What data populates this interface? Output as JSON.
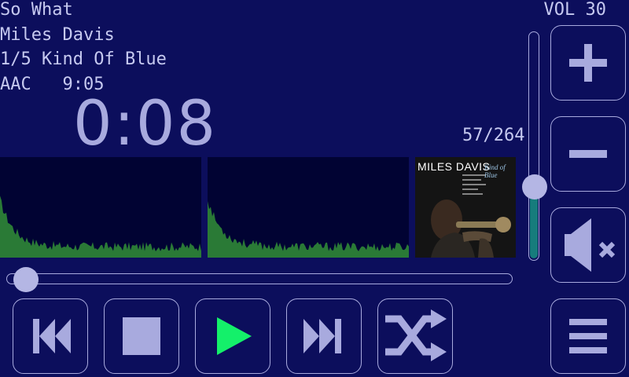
{
  "track": {
    "title": "So What",
    "artist": "Miles Davis",
    "album_line": "1/5 Kind Of Blue",
    "format_line": "AAC   9:05",
    "elapsed": "0:08",
    "counter": "57/264"
  },
  "volume": {
    "label": "VOL 30",
    "level": 0.3
  },
  "seek": {
    "fraction": 0.015
  },
  "album_art": {
    "artist_text": "MILES DAVIS",
    "album_text": "Kind of Blue"
  },
  "visualizer": {
    "color": "#2a7a36",
    "background": "#010333"
  },
  "colors": {
    "background": "#0c0e5c",
    "foreground": "#a8aade",
    "play_accent": "#14f06a",
    "volume_fill": "#167c7c"
  },
  "buttons": {
    "prev": "previous-icon",
    "stop": "stop-icon",
    "play": "play-icon",
    "next": "next-icon",
    "shuffle": "shuffle-icon",
    "menu": "menu-icon",
    "vol_up": "plus-icon",
    "vol_down": "minus-icon",
    "mute": "mute-icon"
  }
}
